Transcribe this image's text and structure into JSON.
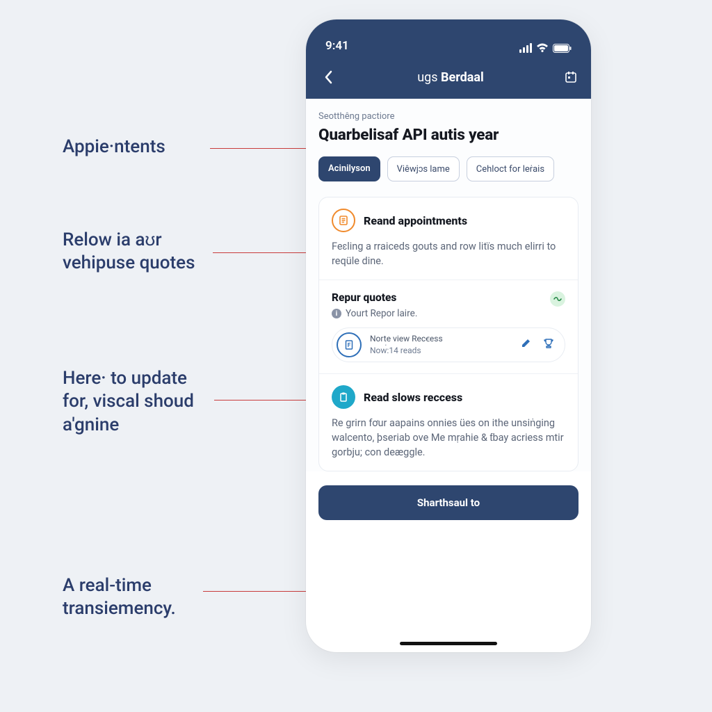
{
  "annotations": {
    "a1": "Appie·ntents",
    "a2_l1": "Relow ia aʊr",
    "a2_l2": "vehipuse quotes",
    "a3_l1": "Here· to update",
    "a3_l2": "for, viscal shoud",
    "a3_l3": "a'gnine",
    "a4_l1": "A real-time",
    "a4_l2": "transiemency."
  },
  "status": {
    "time": "9:41"
  },
  "nav": {
    "title_pre": "ugs ",
    "title_bold": "Berdaal"
  },
  "eyebrow": "Seotthêng pactiore",
  "page_title": "Quarbelisaf API autis year",
  "pills": {
    "p1": "Acinilyson",
    "p2": "Viêwjɔs lame",
    "p3": "Cehloct for leṙais"
  },
  "card1": {
    "title": "Reand appointments",
    "body": "Feɛling a rraiceds gouts and row litïs much elirri to reqüle dine."
  },
  "card2": {
    "title": "Repur quotes",
    "sub": "Yourt Repor lairе.",
    "item_l1": "Norte view Recꞓess",
    "item_l2": "Now่:14 reads"
  },
  "card3": {
    "title": "Read slows reccess",
    "body": "Re grirn fơur aapains onnies ües on ithe unsiṅging walcento, þseriab ove Me mṛahie & ƭbay aᴄriess mtir gorbju; con deæggle."
  },
  "cta_label": "Sharthsaul to"
}
